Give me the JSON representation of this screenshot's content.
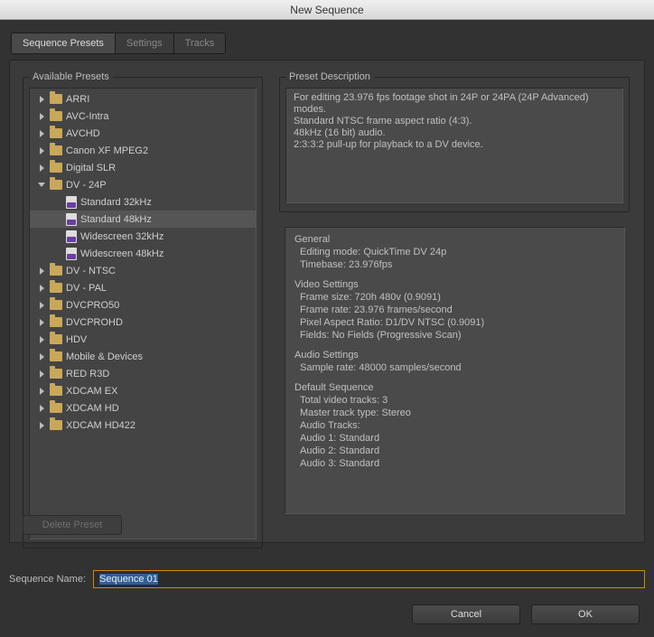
{
  "title": "New Sequence",
  "tabs": [
    "Sequence Presets",
    "Settings",
    "Tracks"
  ],
  "available_presets_label": "Available Presets",
  "preset_description_label": "Preset Description",
  "delete_preset_label": "Delete Preset",
  "sequence_name_label": "Sequence Name:",
  "sequence_name_value": "Sequence 01",
  "cancel_label": "Cancel",
  "ok_label": "OK",
  "folders_top": [
    "ARRI",
    "AVC-Intra",
    "AVCHD",
    "Canon XF MPEG2",
    "Digital SLR"
  ],
  "open_folder": "DV - 24P",
  "open_children": [
    "Standard 32kHz",
    "Standard 48kHz",
    "Widescreen 32kHz",
    "Widescreen 48kHz"
  ],
  "selected_child_index": 1,
  "folders_bottom": [
    "DV - NTSC",
    "DV - PAL",
    "DVCPRO50",
    "DVCPROHD",
    "HDV",
    "Mobile & Devices",
    "RED R3D",
    "XDCAM EX",
    "XDCAM HD",
    "XDCAM HD422"
  ],
  "desc_lines": [
    "For editing 23.976 fps footage shot in 24P or 24PA (24P Advanced) modes.",
    "Standard NTSC frame aspect ratio (4:3).",
    "48kHz (16 bit) audio.",
    "2:3:3:2 pull-up for playback to a DV device."
  ],
  "detail": {
    "general_hdr": "General",
    "editing_mode": "Editing mode: QuickTime DV 24p",
    "timebase": "Timebase: 23.976fps",
    "video_hdr": "Video Settings",
    "frame_size": "Frame size: 720h 480v (0.9091)",
    "frame_rate": "Frame rate: 23.976 frames/second",
    "par": "Pixel Aspect Ratio: D1/DV NTSC (0.9091)",
    "fields": "Fields: No Fields (Progressive Scan)",
    "audio_hdr": "Audio Settings",
    "sample_rate": "Sample rate: 48000 samples/second",
    "defseq_hdr": "Default Sequence",
    "vtracks": "Total video tracks: 3",
    "mtrack": "Master track type: Stereo",
    "atracks_hdr": "Audio Tracks:",
    "a1": "Audio 1: Standard",
    "a2": "Audio 2: Standard",
    "a3": "Audio 3: Standard"
  }
}
